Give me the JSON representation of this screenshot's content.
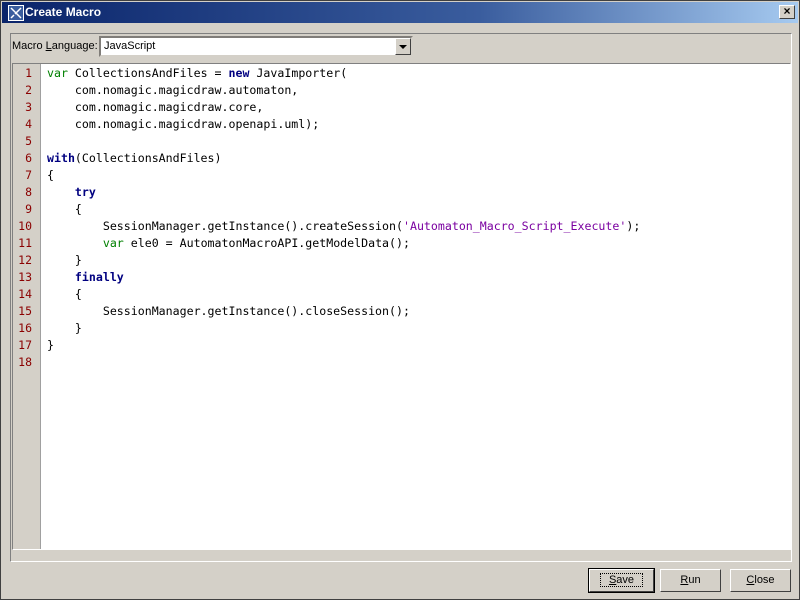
{
  "window": {
    "title": "Create Macro",
    "close_label": "×"
  },
  "language": {
    "label_pre": "Macro ",
    "label_mnemonic": "L",
    "label_post": "anguage:",
    "value": "JavaScript"
  },
  "editor": {
    "lines": [
      [
        [
          "k",
          "var"
        ],
        [
          "t",
          " CollectionsAndFiles = "
        ],
        [
          "b",
          "new"
        ],
        [
          "t",
          " JavaImporter("
        ]
      ],
      [
        [
          "t",
          "    com.nomagic.magicdraw.automaton,"
        ]
      ],
      [
        [
          "t",
          "    com.nomagic.magicdraw.core,"
        ]
      ],
      [
        [
          "t",
          "    com.nomagic.magicdraw.openapi.uml);"
        ]
      ],
      [],
      [
        [
          "b",
          "with"
        ],
        [
          "t",
          "(CollectionsAndFiles)"
        ]
      ],
      [
        [
          "t",
          "{"
        ]
      ],
      [
        [
          "t",
          "    "
        ],
        [
          "b",
          "try"
        ]
      ],
      [
        [
          "t",
          "    {"
        ]
      ],
      [
        [
          "t",
          "        SessionManager.getInstance().createSession("
        ],
        [
          "s",
          "'Automaton_Macro_Script_Execute'"
        ],
        [
          "t",
          ");"
        ]
      ],
      [
        [
          "t",
          "        "
        ],
        [
          "k",
          "var"
        ],
        [
          "t",
          " ele0 = AutomatonMacroAPI.getModelData();"
        ]
      ],
      [
        [
          "t",
          "    }"
        ]
      ],
      [
        [
          "t",
          "    "
        ],
        [
          "b",
          "finally"
        ]
      ],
      [
        [
          "t",
          "    {"
        ]
      ],
      [
        [
          "t",
          "        SessionManager.getInstance().closeSession();"
        ]
      ],
      [
        [
          "t",
          "    }"
        ]
      ],
      [
        [
          "t",
          "}"
        ]
      ],
      []
    ]
  },
  "buttons": {
    "save": {
      "mn": "S",
      "rest": "ave"
    },
    "run": {
      "mn": "R",
      "rest": "un"
    },
    "close": {
      "mn": "C",
      "rest": "lose"
    }
  }
}
